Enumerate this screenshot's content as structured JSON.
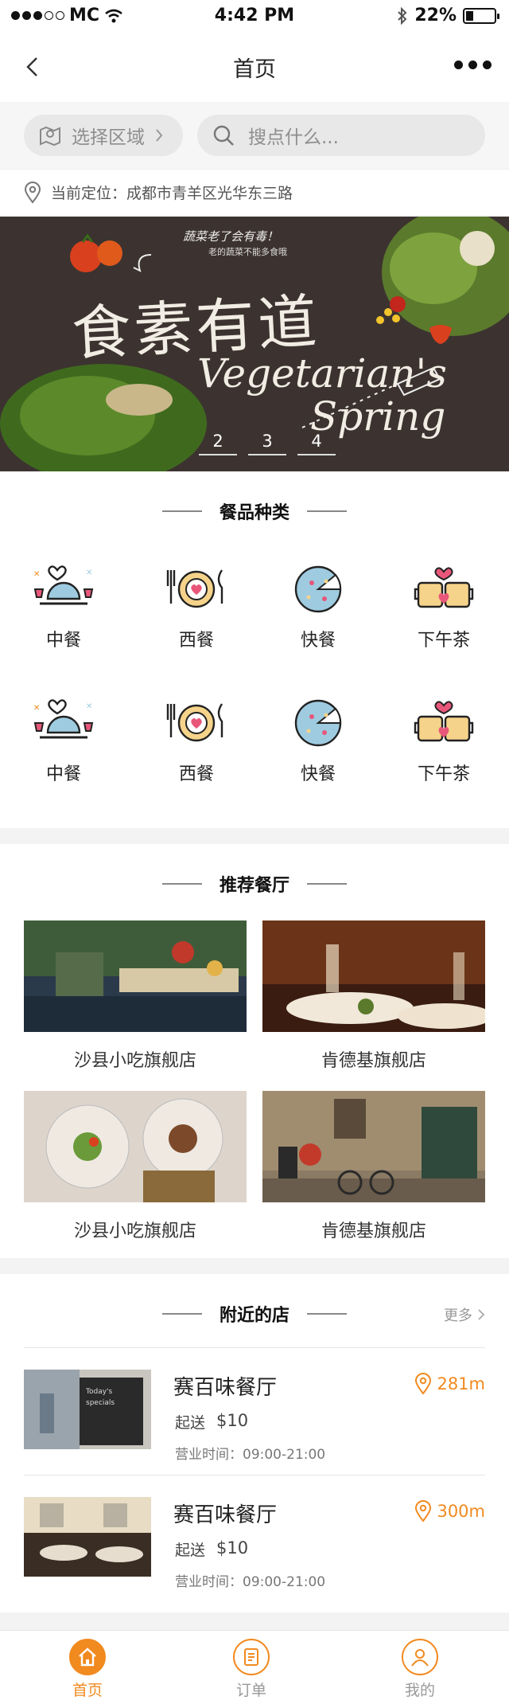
{
  "status_bar": {
    "carrier": "MC",
    "time": "4:42 PM",
    "battery": "22%"
  },
  "navbar": {
    "title": "首页"
  },
  "search": {
    "region_label": "选择区域",
    "placeholder": "搜点什么..."
  },
  "location": {
    "text": "当前定位：成都市青羊区光华东三路"
  },
  "banner": {
    "title_cn": "食素有道",
    "title_en_1": "Vegetarian's",
    "title_en_2": "Spring",
    "tagline": "蔬菜老了会有毒！",
    "sub_tagline": "老的蔬菜不能多食哦",
    "pager": [
      "2",
      "3",
      "4"
    ]
  },
  "categories": {
    "title": "餐品种类",
    "items": [
      {
        "label": "中餐",
        "icon": "cloche-icon"
      },
      {
        "label": "西餐",
        "icon": "plate-icon"
      },
      {
        "label": "快餐",
        "icon": "pizza-icon"
      },
      {
        "label": "下午茶",
        "icon": "tea-cups-icon"
      },
      {
        "label": "中餐",
        "icon": "cloche-icon"
      },
      {
        "label": "西餐",
        "icon": "plate-icon"
      },
      {
        "label": "快餐",
        "icon": "pizza-icon"
      },
      {
        "label": "下午茶",
        "icon": "tea-cups-icon"
      }
    ]
  },
  "recommended": {
    "title": "推荐餐厅",
    "items": [
      {
        "name": "沙县小吃旗舰店"
      },
      {
        "name": "肯德基旗舰店"
      },
      {
        "name": "沙县小吃旗舰店"
      },
      {
        "name": "肯德基旗舰店"
      }
    ]
  },
  "nearby": {
    "title": "附近的店",
    "more": "更多",
    "items": [
      {
        "name": "赛百味餐厅",
        "price_label": "起送",
        "price": "$10",
        "hours": "营业时间：09:00-21:00",
        "distance": "281m"
      },
      {
        "name": "赛百味餐厅",
        "price_label": "起送",
        "price": "$10",
        "hours": "营业时间：09:00-21:00",
        "distance": "300m"
      }
    ]
  },
  "tabbar": {
    "items": [
      {
        "label": "首页",
        "icon": "home-icon",
        "active": true
      },
      {
        "label": "订单",
        "icon": "order-icon",
        "active": false
      },
      {
        "label": "我的",
        "icon": "user-icon",
        "active": false
      }
    ]
  },
  "colors": {
    "accent": "#f18a1f",
    "heart": "#e8577a",
    "food_icon_yellow": "#f5d38a",
    "food_icon_blue": "#9ecbe0"
  }
}
